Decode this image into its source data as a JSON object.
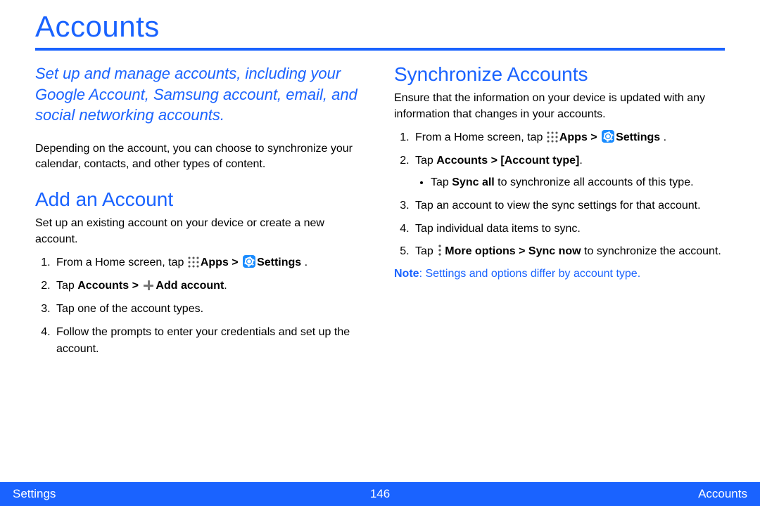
{
  "title": "Accounts",
  "intro": "Set up and manage accounts, including your Google Account, Samsung account, email, and social networking accounts.",
  "para1": "Depending on the account, you can choose to synchronize your calendar, contacts, and other types of content.",
  "section_add": {
    "heading": "Add an Account",
    "body": "Set up an existing account on your device or create a new account.",
    "step1_a": "From a Home screen, tap ",
    "apps_label": "Apps > ",
    "settings_label": "Settings",
    "step1_c": " .",
    "step2_a": "Tap ",
    "step2_b": "Accounts > ",
    "step2_c": "Add account",
    "step2_d": ".",
    "step3": "Tap one of the account types.",
    "step4": "Follow the prompts to enter your credentials and set up the account."
  },
  "section_sync": {
    "heading": "Synchronize Accounts",
    "body": "Ensure that the information on your device is updated with any information that changes in your accounts.",
    "step1_a": "From a Home screen, tap ",
    "apps_label": "Apps > ",
    "settings_label": "Settings",
    "step1_c": " .",
    "step2_a": "Tap ",
    "step2_b": "Accounts > [Account type]",
    "step2_c": ".",
    "bullet_a": "Tap ",
    "bullet_b": "Sync all",
    "bullet_c": " to synchronize all accounts of this type.",
    "step3": "Tap an account to view the sync settings for that account.",
    "step4": "Tap individual data items to sync.",
    "step5_a": "Tap ",
    "step5_b": "More options > Sync now",
    "step5_c": " to synchronize the account.",
    "note_label": "Note",
    "note_body": ": Settings and options differ by account type."
  },
  "footer": {
    "left": "Settings",
    "center": "146",
    "right": "Accounts"
  }
}
